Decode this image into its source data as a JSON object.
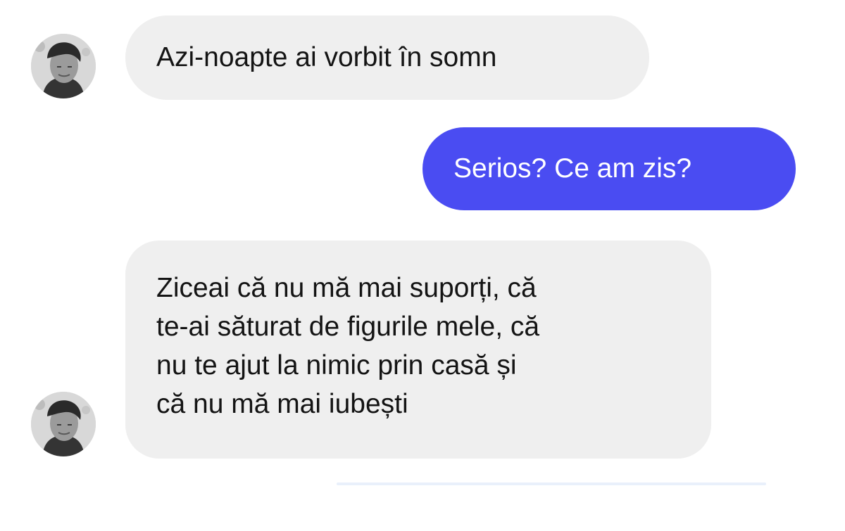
{
  "conversation": {
    "messages": [
      {
        "sender": "contact",
        "text": "Azi-noapte ai vorbit în somn"
      },
      {
        "sender": "me",
        "text": "Serios? Ce am zis?"
      },
      {
        "sender": "contact",
        "text": "Ziceai că nu mă mai suporți, că\nte-ai săturat de figurile mele, că\nnu te ajut la nimic prin casă și\ncă nu mă mai iubești"
      }
    ]
  },
  "colors": {
    "incoming_bubble": "#efefef",
    "outgoing_bubble": "#4a4cf2",
    "incoming_text": "#141414",
    "outgoing_text": "#ffffff"
  },
  "icons": {
    "contact_avatar": "profile-photo-avatar-icon"
  }
}
